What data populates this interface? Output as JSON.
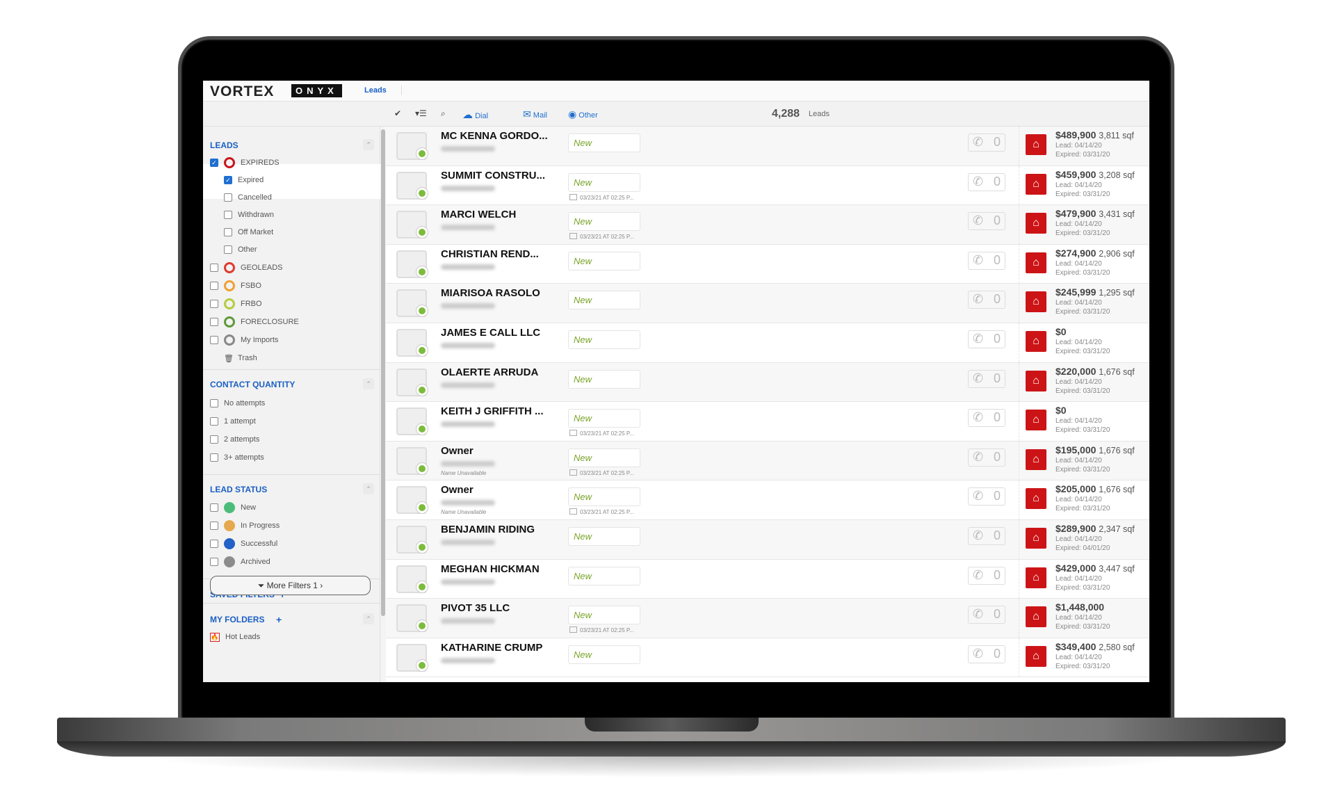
{
  "app": {
    "logo": "VORTEX",
    "product": "ONYX",
    "nav_active": "Leads"
  },
  "toolbar": {
    "check_icon": "check-icon",
    "dial": "Dial",
    "mail": "Mail",
    "other": "Other",
    "lead_count": "4,288",
    "lead_count_label": "Leads"
  },
  "sidebar": {
    "leads_title": "LEADS",
    "leads": [
      {
        "label": "EXPIREDS",
        "checked": true,
        "color": "#c8151b"
      },
      {
        "label": "Expired",
        "checked": true,
        "sub": true
      },
      {
        "label": "Cancelled",
        "checked": false,
        "sub": true
      },
      {
        "label": "Withdrawn",
        "checked": false,
        "sub": true
      },
      {
        "label": "Off Market",
        "checked": false,
        "sub": true
      },
      {
        "label": "Other",
        "checked": false,
        "sub": true
      },
      {
        "label": "GEOLEADS",
        "checked": false,
        "color": "#e03a2e"
      },
      {
        "label": "FSBO",
        "checked": false,
        "color": "#f0a033"
      },
      {
        "label": "FRBO",
        "checked": false,
        "color": "#b6cc3e"
      },
      {
        "label": "FORECLOSURE",
        "checked": false,
        "color": "#5f9a3a"
      },
      {
        "label": "My Imports",
        "checked": false,
        "color": "#888888"
      },
      {
        "label": "Trash",
        "trash": true
      }
    ],
    "contact_title": "CONTACT QUANTITY",
    "contact": [
      "No attempts",
      "1 attempt",
      "2 attempts",
      "3+ attempts"
    ],
    "status_title": "LEAD STATUS",
    "statuses": [
      {
        "label": "New",
        "color": "#4cbc7a"
      },
      {
        "label": "In Progress",
        "color": "#e6a84e"
      },
      {
        "label": "Successful",
        "color": "#2360c8"
      },
      {
        "label": "Archived",
        "color": "#8c8c8c"
      }
    ],
    "saved_title": "SAVED FILTERS",
    "more_filters": "More Filters 1 ›",
    "folders_title": "MY FOLDERS",
    "folders": [
      "Hot Leads"
    ]
  },
  "rows": [
    {
      "name": "MC KENNA GORDO...",
      "status": "New",
      "price": "$489,900",
      "sqf": "3,811 sqf",
      "lead": "Lead: 04/14/20",
      "expired": "Expired: 03/31/20"
    },
    {
      "name": "SUMMIT CONSTRU...",
      "status": "New",
      "date": "03/23/21 AT 02:25 P...",
      "price": "$459,900",
      "sqf": "3,208 sqf",
      "lead": "Lead: 04/14/20",
      "expired": "Expired: 03/31/20"
    },
    {
      "name": "MARCI WELCH",
      "status": "New",
      "date": "03/23/21 AT 02:25 P...",
      "price": "$479,900",
      "sqf": "3,431 sqf",
      "lead": "Lead: 04/14/20",
      "expired": "Expired: 03/31/20"
    },
    {
      "name": "CHRISTIAN REND...",
      "status": "New",
      "price": "$274,900",
      "sqf": "2,906 sqf",
      "lead": "Lead: 04/14/20",
      "expired": "Expired: 03/31/20"
    },
    {
      "name": "MIARISOA RASOLO",
      "status": "New",
      "price": "$245,999",
      "sqf": "1,295 sqf",
      "lead": "Lead: 04/14/20",
      "expired": "Expired: 03/31/20"
    },
    {
      "name": "JAMES E CALL LLC",
      "status": "New",
      "price": "$0",
      "sqf": "",
      "lead": "Lead: 04/14/20",
      "expired": "Expired: 03/31/20"
    },
    {
      "name": "OLAERTE ARRUDA",
      "status": "New",
      "price": "$220,000",
      "sqf": "1,676 sqf",
      "lead": "Lead: 04/14/20",
      "expired": "Expired: 03/31/20"
    },
    {
      "name": "KEITH J GRIFFITH ...",
      "status": "New",
      "date": "03/23/21 AT 02:25 P...",
      "price": "$0",
      "sqf": "",
      "lead": "Lead: 04/14/20",
      "expired": "Expired: 03/31/20"
    },
    {
      "name": "Owner",
      "note": "Name Unavailable",
      "status": "New",
      "date": "03/23/21 AT 02:25 P...",
      "price": "$195,000",
      "sqf": "1,676 sqf",
      "lead": "Lead: 04/14/20",
      "expired": "Expired: 03/31/20"
    },
    {
      "name": "Owner",
      "note": "Name Unavailable",
      "status": "New",
      "date": "03/23/21 AT 02:25 P...",
      "price": "$205,000",
      "sqf": "1,676 sqf",
      "lead": "Lead: 04/14/20",
      "expired": "Expired: 03/31/20"
    },
    {
      "name": "BENJAMIN RIDING",
      "status": "New",
      "price": "$289,900",
      "sqf": "2,347 sqf",
      "lead": "Lead: 04/14/20",
      "expired": "Expired: 04/01/20"
    },
    {
      "name": "MEGHAN HICKMAN",
      "status": "New",
      "price": "$429,000",
      "sqf": "3,447 sqf",
      "lead": "Lead: 04/14/20",
      "expired": "Expired: 03/31/20"
    },
    {
      "name": "PIVOT 35 LLC",
      "status": "New",
      "date": "03/23/21 AT 02:25 P...",
      "price": "$1,448,000",
      "sqf": "",
      "lead": "Lead: 04/14/20",
      "expired": "Expired: 03/31/20"
    },
    {
      "name": "KATHARINE CRUMP",
      "status": "New",
      "price": "$349,400",
      "sqf": "2,580 sqf",
      "lead": "Lead: 04/14/20",
      "expired": "Expired: 03/31/20"
    }
  ],
  "call_count": "0",
  "colors": {
    "accent": "#1a5fc4",
    "status_new": "#7aa42a",
    "expired_red": "#cc1417"
  }
}
